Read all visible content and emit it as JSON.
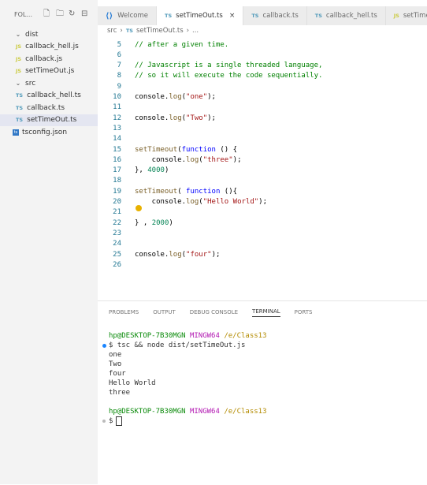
{
  "sidebar": {
    "header": "FOL...",
    "items": [
      {
        "label": "dist",
        "type": "folder",
        "depth": 0
      },
      {
        "label": "callback_hell.js",
        "type": "js",
        "depth": 1
      },
      {
        "label": "callback.js",
        "type": "js",
        "depth": 1
      },
      {
        "label": "setTimeOut.js",
        "type": "js",
        "depth": 1
      },
      {
        "label": "src",
        "type": "folder",
        "depth": 0
      },
      {
        "label": "callback_hell.ts",
        "type": "ts",
        "depth": 1
      },
      {
        "label": "callback.ts",
        "type": "ts",
        "depth": 1
      },
      {
        "label": "setTimeOut.ts",
        "type": "ts",
        "depth": 1,
        "selected": true
      },
      {
        "label": "tsconfig.json",
        "type": "json",
        "depth": 0
      }
    ]
  },
  "tabs": [
    {
      "label": "Welcome",
      "icon": "vscode-icon"
    },
    {
      "label": "setTimeOut.ts",
      "icon": "TS",
      "active": true
    },
    {
      "label": "callback.ts",
      "icon": "TS"
    },
    {
      "label": "callback_hell.ts",
      "icon": "TS"
    },
    {
      "label": "setTime",
      "icon": "JS"
    }
  ],
  "breadcrumb": {
    "folder": "src",
    "file": "setTimeOut.ts",
    "more": "..."
  },
  "editor": {
    "lines": [
      {
        "n": "5",
        "html": "<span class='cm'>// after a given time.</span>"
      },
      {
        "n": "6",
        "html": ""
      },
      {
        "n": "7",
        "html": "<span class='cm'>// Javascript is a single threaded language,</span>"
      },
      {
        "n": "8",
        "html": "<span class='cm'>// so it will execute the code sequentially.</span>"
      },
      {
        "n": "9",
        "html": ""
      },
      {
        "n": "10",
        "html": "console.<span class='fn'>log</span>(<span class='str'>\"one\"</span>);"
      },
      {
        "n": "11",
        "html": ""
      },
      {
        "n": "12",
        "html": "console.<span class='fn'>log</span>(<span class='str'>\"Two\"</span>);"
      },
      {
        "n": "13",
        "html": ""
      },
      {
        "n": "14",
        "html": ""
      },
      {
        "n": "15",
        "html": "<span class='fn'>setTimeout</span>(<span class='kw'>function</span> () {"
      },
      {
        "n": "16",
        "html": "    console.<span class='fn'>log</span>(<span class='str'>\"three\"</span>);"
      },
      {
        "n": "17",
        "html": "}, <span class='num'>4000</span>)"
      },
      {
        "n": "18",
        "html": ""
      },
      {
        "n": "19",
        "html": "<span class='fn'>setTimeout</span>( <span class='kw'>function</span> (){"
      },
      {
        "n": "20",
        "html": "    console.<span class='fn'>log</span>(<span class='str'>\"Hello World\"</span>);"
      },
      {
        "n": "21",
        "html": ""
      },
      {
        "n": "22",
        "html": "} , <span class='num'>2000</span>)"
      },
      {
        "n": "23",
        "html": ""
      },
      {
        "n": "24",
        "html": ""
      },
      {
        "n": "25",
        "html": "console.<span class='fn'>log</span>(<span class='str'>\"four\"</span>);"
      },
      {
        "n": "26",
        "html": ""
      }
    ]
  },
  "panel": {
    "tabs": [
      "PROBLEMS",
      "OUTPUT",
      "DEBUG CONSOLE",
      "TERMINAL",
      "PORTS"
    ],
    "active_tab": "TERMINAL"
  },
  "terminal": {
    "prompt1_user": "hp@DESKTOP-7B30MGN",
    "prompt1_host": "MINGW64",
    "prompt1_path": "/e/Class13",
    "command": "$ tsc && node dist/setTimeOut.js",
    "output": [
      "one",
      "Two",
      "four",
      "Hello World",
      "three"
    ],
    "prompt2_user": "hp@DESKTOP-7B30MGN",
    "prompt2_host": "MINGW64",
    "prompt2_path": "/e/Class13",
    "prompt2_symbol": "$"
  }
}
